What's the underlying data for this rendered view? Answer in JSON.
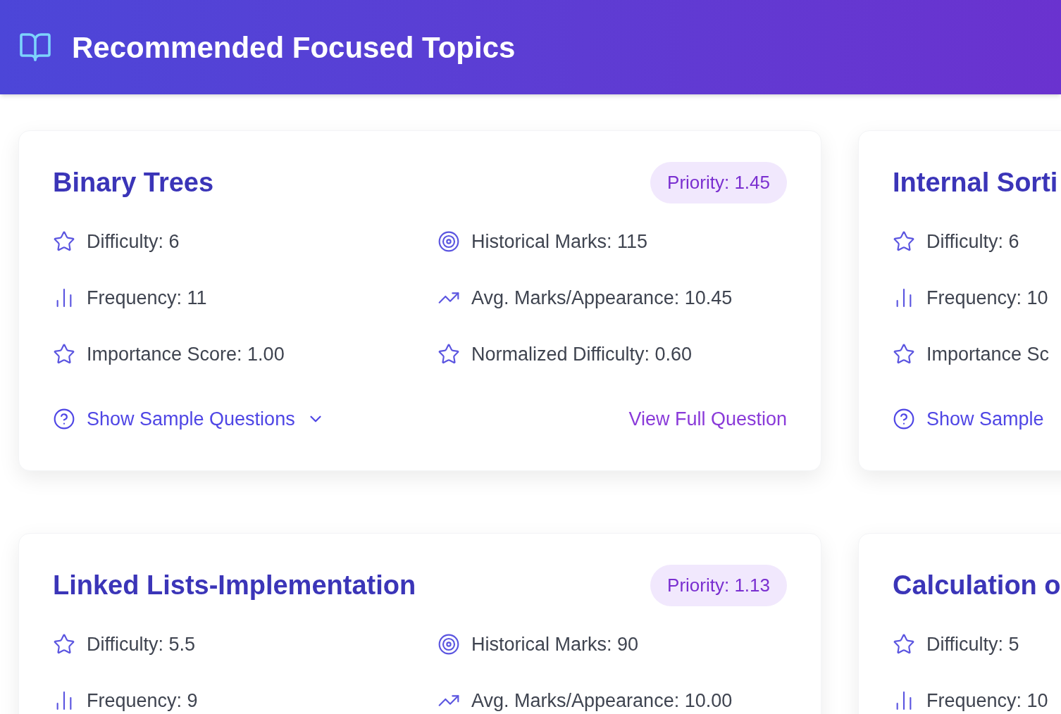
{
  "header": {
    "title": "Recommended Focused Topics"
  },
  "rows": [
    {
      "cards": [
        {
          "title": "Binary Trees",
          "priority": "Priority: 1.45",
          "stats_left": [
            {
              "kind": "star",
              "text": "Difficulty: 6"
            },
            {
              "kind": "bars",
              "text": "Frequency: 11"
            },
            {
              "kind": "star",
              "text": "Importance Score: 1.00"
            }
          ],
          "stats_right": [
            {
              "kind": "target",
              "text": "Historical Marks: 115"
            },
            {
              "kind": "trend",
              "text": "Avg. Marks/Appearance: 10.45"
            },
            {
              "kind": "star",
              "text": "Normalized Difficulty: 0.60"
            }
          ],
          "sample_button": "Show Sample Questions",
          "expanded": false,
          "view_link": "View Full Question"
        },
        {
          "title": "Internal Sorti",
          "stats_left": [
            {
              "kind": "star",
              "text": "Difficulty: 6"
            },
            {
              "kind": "bars",
              "text": "Frequency: 10"
            },
            {
              "kind": "star",
              "text": "Importance Sc"
            }
          ],
          "sample_button": "Show Sample"
        }
      ]
    },
    {
      "cards": [
        {
          "title": "Linked Lists-Implementation",
          "priority": "Priority: 1.13",
          "stats_left": [
            {
              "kind": "star",
              "text": "Difficulty: 5.5"
            },
            {
              "kind": "bars",
              "text": "Frequency: 9"
            }
          ],
          "stats_right": [
            {
              "kind": "target",
              "text": "Historical Marks: 90"
            },
            {
              "kind": "trend",
              "text": "Avg. Marks/Appearance: 10.00"
            }
          ]
        },
        {
          "title": "Calculation o",
          "stats_left": [
            {
              "kind": "star",
              "text": "Difficulty: 5"
            },
            {
              "kind": "bars",
              "text": "Frequency: 10"
            }
          ]
        }
      ]
    }
  ]
}
